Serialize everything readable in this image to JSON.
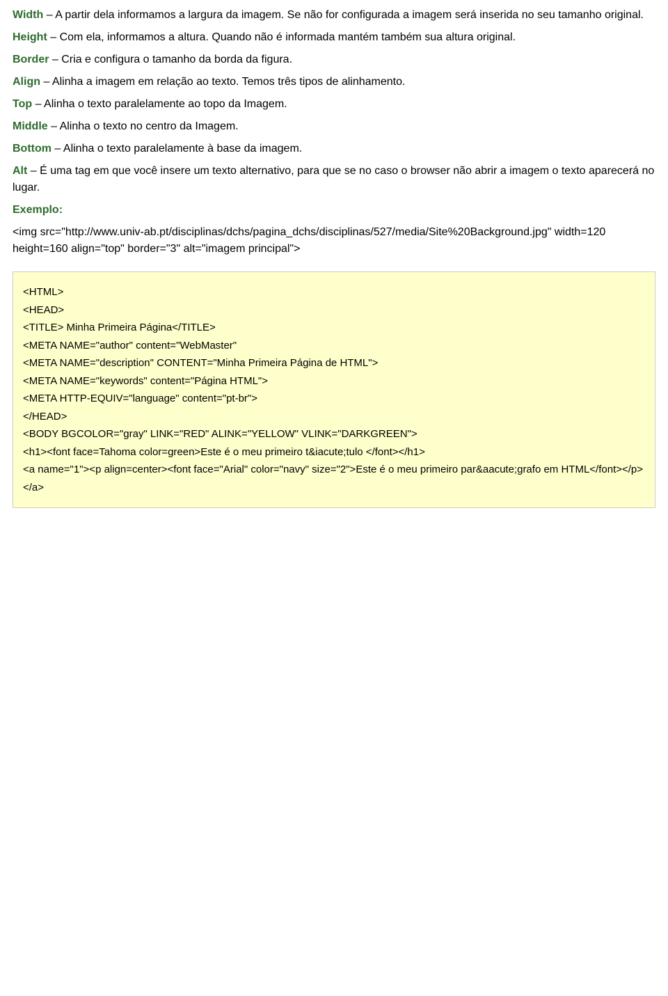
{
  "content": {
    "paragraphs": [
      {
        "id": "width-para",
        "keyword": "Width",
        "dash": " – ",
        "text": "A partir dela informamos a largura da imagem. Se não for configurada a imagem será inserida no seu tamanho original."
      },
      {
        "id": "height-para",
        "keyword": "Height",
        "dash": " – ",
        "text": "Com ela, informamos a altura. Quando não é informada mantém também sua altura original."
      },
      {
        "id": "border-para",
        "keyword": "Border",
        "dash": " – ",
        "text": "Cria e configura o tamanho da borda da figura."
      },
      {
        "id": "align-para",
        "keyword": "Align",
        "dash": " – ",
        "text": "Alinha a imagem em relação ao texto. Temos três tipos de alinhamento."
      },
      {
        "id": "top-para",
        "keyword": "Top",
        "dash": " – ",
        "text": "Alinha o texto paralelamente ao topo da Imagem."
      },
      {
        "id": "middle-para",
        "keyword": "Middle",
        "dash": " – ",
        "text": "Alinha o texto no centro da Imagem."
      },
      {
        "id": "bottom-para",
        "keyword": "Bottom",
        "dash": " – ",
        "text": "Alinha o texto paralelamente à base da imagem."
      },
      {
        "id": "alt-para",
        "keyword": "Alt",
        "dash": " – ",
        "text": "É uma tag em que você insere um texto alternativo, para que se no caso o browser não abrir a imagem o texto aparecerá no lugar."
      }
    ],
    "exemplo": {
      "label": "Exemplo:",
      "code_line1": "<img src=\"http://www.univ-ab.pt/disciplinas/dchs/pagina_dchs/disciplinas/527/media/Site%20Background.jpg\" width=120 height=160 align=\"top\" border=\"3\" alt=\"imagem principal\">"
    },
    "code_block": {
      "lines": [
        "<HTML>",
        "<HEAD>",
        "<TITLE> Minha Primeira Página</TITLE>",
        "<META NAME=\"author\" content=\"WebMaster\"",
        "<META NAME=\"description\" CONTENT=\"Minha Primeira Página de HTML\">",
        "<META NAME=\"keywords\" content=\"Página HTML\">",
        "<META HTTP-EQUIV=\"language\" content=\"pt-br\">",
        "</HEAD>",
        "<BODY BGCOLOR=\"gray\" LINK=\"RED\" ALINK=\"YELLOW\" VLINK=\"DARKGREEN\">",
        "<h1><font face=Tahoma color=green>Este é o meu primeiro t&iacute;tulo </font></h1>",
        "<a name=\"1\"><p align=center><font face=\"Arial\" color=\"navy\" size=\"2\">Este é o meu primeiro par&aacute;grafo em HTML</font></p></a>"
      ]
    }
  }
}
